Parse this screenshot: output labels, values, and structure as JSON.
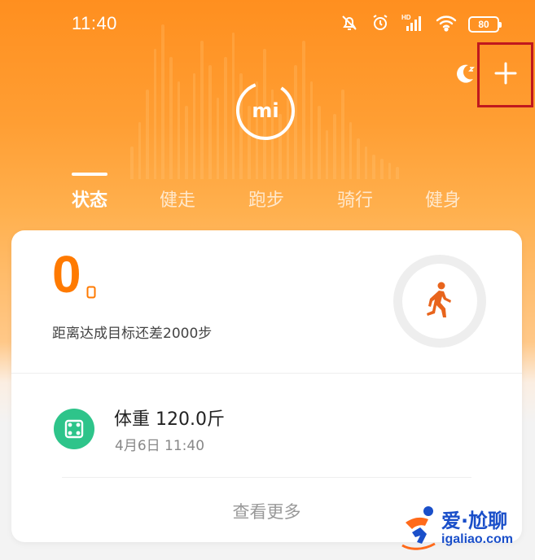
{
  "status_bar": {
    "time": "11:40",
    "battery": "80",
    "icons": [
      "mute-icon",
      "alarm-icon",
      "hd-signal-icon",
      "wifi-icon",
      "battery-icon"
    ]
  },
  "header": {
    "logo_text": "mi",
    "icons": [
      "moon-icon",
      "add-icon"
    ]
  },
  "tabs": [
    {
      "label": "状态",
      "active": true
    },
    {
      "label": "健走",
      "active": false
    },
    {
      "label": "跑步",
      "active": false
    },
    {
      "label": "骑行",
      "active": false
    },
    {
      "label": "健身",
      "active": false
    }
  ],
  "steps_card": {
    "steps": "0",
    "goal_text": "距离达成目标还差2000步"
  },
  "weight_card": {
    "title": "体重 120.0斤",
    "date": "4月6日 11:40"
  },
  "more_label": "查看更多",
  "watermark": {
    "title": "爱·尬聊",
    "url": "igaliao.com"
  },
  "colors": {
    "accent": "#ff7a00",
    "header_orange": "#ff8f1f",
    "scale_green": "#2ec48a",
    "highlight_box": "#c0181e"
  }
}
